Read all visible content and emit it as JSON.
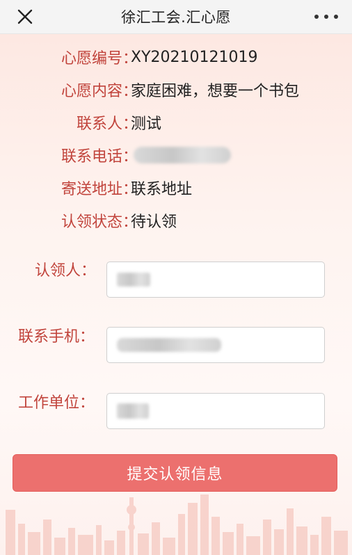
{
  "header": {
    "title": "徐汇工会.汇心愿"
  },
  "info": {
    "rows": [
      {
        "label": "心愿编号",
        "value": "XY20210121019"
      },
      {
        "label": "心愿内容",
        "value": "家庭困难，想要一个书包"
      },
      {
        "label": "联系人",
        "value": "测试"
      },
      {
        "label": "联系电话",
        "value": ""
      },
      {
        "label": "寄送地址",
        "value": "联系地址"
      },
      {
        "label": "认领状态",
        "value": "待认领"
      }
    ],
    "colon": "："
  },
  "form": {
    "claimant_label": "认领人：",
    "phone_label": "联系手机：",
    "company_label": "工作单位："
  },
  "submit_label": "提交认领信息",
  "colors": {
    "accent": "#c1443c",
    "button": "#ec706e"
  }
}
